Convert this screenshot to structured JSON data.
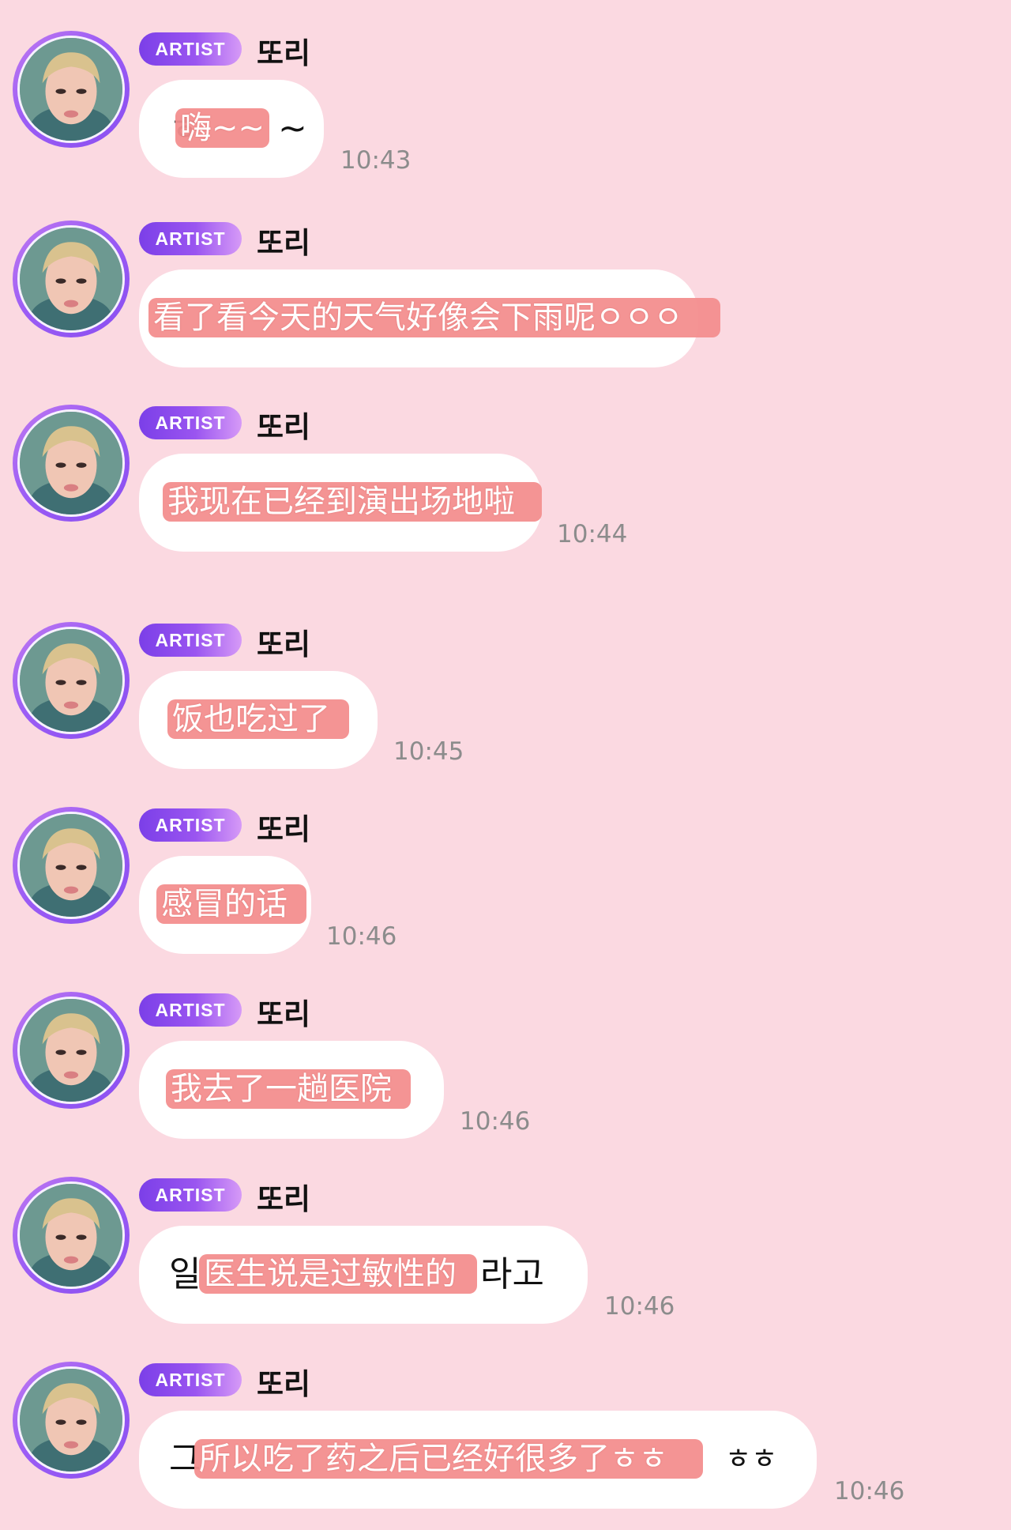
{
  "colors": {
    "background": "#fbd9e1",
    "bubble": "#ffffff",
    "badge_start": "#7b3fe8",
    "badge_end": "#d69af7",
    "highlight": "#f38e8e",
    "time_text": "#8c8c8c",
    "avatar_ring": "#9b5cf5"
  },
  "messages": [
    {
      "badge": "ARTIST",
      "sender": "또리",
      "icon": "avatar",
      "left_text": "ㅎ",
      "translation": "嗨~~",
      "right_text": "~",
      "time": "10:43"
    },
    {
      "badge": "ARTIST",
      "sender": "또리",
      "icon": "avatar",
      "left_text": "",
      "translation": "看了看今天的天气好像会下雨呢ㅇㅇㅇ",
      "right_text": "",
      "time": ""
    },
    {
      "badge": "ARTIST",
      "sender": "또리",
      "icon": "avatar",
      "left_text": "",
      "translation": "我现在已经到演出场地啦",
      "right_text": "",
      "time": "10:44"
    },
    {
      "badge": "ARTIST",
      "sender": "또리",
      "icon": "avatar",
      "left_text": "",
      "translation": "饭也吃过了",
      "right_text": "",
      "time": "10:45"
    },
    {
      "badge": "ARTIST",
      "sender": "또리",
      "icon": "avatar",
      "left_text": "",
      "translation": "感冒的话",
      "right_text": "",
      "time": "10:46"
    },
    {
      "badge": "ARTIST",
      "sender": "또리",
      "icon": "avatar",
      "left_text": "",
      "translation": "我去了一趟医院",
      "right_text": "",
      "time": "10:46"
    },
    {
      "badge": "ARTIST",
      "sender": "또리",
      "icon": "avatar",
      "left_text": "일",
      "translation": "医生说是过敏性的",
      "right_text": "라고",
      "time": "10:46"
    },
    {
      "badge": "ARTIST",
      "sender": "또리",
      "icon": "avatar",
      "left_text": "그",
      "translation": "所以吃了药之后已经好很多了ㅎㅎ",
      "right_text": "ㅎㅎ",
      "time": "10:46"
    }
  ]
}
